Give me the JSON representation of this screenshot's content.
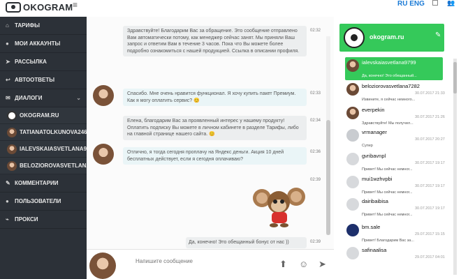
{
  "top": {
    "logo": "OKOGRAM",
    "lang": "RU ENG"
  },
  "nav": {
    "tariffs": "ТАРИФЫ",
    "accounts": "МОИ АККАУНТЫ",
    "mailing": "РАССЫЛКА",
    "autoreplies": "АВТООТВЕТЫ",
    "dialogs": "ДИАЛОГИ",
    "subs": [
      "OKOGRAM.RU",
      "TATIANATOLKUNOVA2461",
      "IALEVSKAIASVETLANA9799",
      "BELOZIOROVASVETLANA7"
    ],
    "comments": "КОММЕНТАРИИ",
    "users": "ПОЛЬЗОВАТЕЛИ",
    "proxy": "ПРОКСИ"
  },
  "chat": {
    "messages": [
      {
        "text": "Здравствуйте! Благодарим Вас за обращение. Это сообщение отправлено Вам автоматически потому, как менеджер сейчас занят. Мы приняли Ваш запрос и ответим Вам в течение 3 часов. Пока что Вы можете более подробно ознакомиться с нашей продукцией. Ссылка в описании профиля.",
        "time": "02:32"
      },
      {
        "text": "Спасибо. Мне очень нравится функционал. Я хочу купить пакет Премиум. Как я могу оплатить сервис? 😊",
        "time": "02:33"
      },
      {
        "text": "Елена, благодарим Вас за проявленный интерес у нашему продукту! Оплатить подписку Вы можете в личном кабинете в разделе Тарифы, либо на главной странице нашего сайта. 😊",
        "time": "02:34"
      },
      {
        "text": "Отлично, я тогда сегодня проплачу на Яндекс деньги. Акция 10 дней бесплатных действует, если я сегодня оплачиваю?",
        "time": "02:36"
      },
      {
        "text": "",
        "time": "02:39"
      },
      {
        "text": "Да, конечно! Это обещанный бонус от нас ))",
        "time": "02:39"
      }
    ]
  },
  "compose": {
    "placeholder": "Напишите сообщение"
  },
  "right": {
    "title": "okogram.ru",
    "contacts": [
      {
        "name": "ialevskaiasvetlana9799",
        "date": "",
        "preview": "Да, конечно! Это обещанный..."
      },
      {
        "name": "beloziorovasvetlana7282",
        "date": "30.07.2017 21:33",
        "preview": "Извините, я сейчас немного..."
      },
      {
        "name": "everpekin",
        "date": "30.07.2017 21:26",
        "preview": "Здравствуйте! Мы получил..."
      },
      {
        "name": "vrmanager",
        "date": "30.07.2017 20:27",
        "preview": "Супер"
      },
      {
        "name": "gvribavnpl",
        "date": "30.07.2017 19:17",
        "preview": "Привет! Мы сейчас немног..."
      },
      {
        "name": "mui1wzhvpbi",
        "date": "30.07.2017 19:17",
        "preview": "Привет! Мы сейчас немног..."
      },
      {
        "name": "dairibaibisa",
        "date": "30.07.2017 19:17",
        "preview": "Привет! Мы сейчас немног..."
      },
      {
        "name": "bm.sale",
        "date": "29.07.2017 15:15",
        "preview": "Привет! Благодарим Вас за..."
      },
      {
        "name": "safinaalisa",
        "date": "29.07.2017 04:01",
        "preview": ""
      }
    ]
  },
  "colors": {
    "accent": "#35c95a",
    "sidebar": "#2c3138",
    "lang": "#1a7ad6"
  }
}
